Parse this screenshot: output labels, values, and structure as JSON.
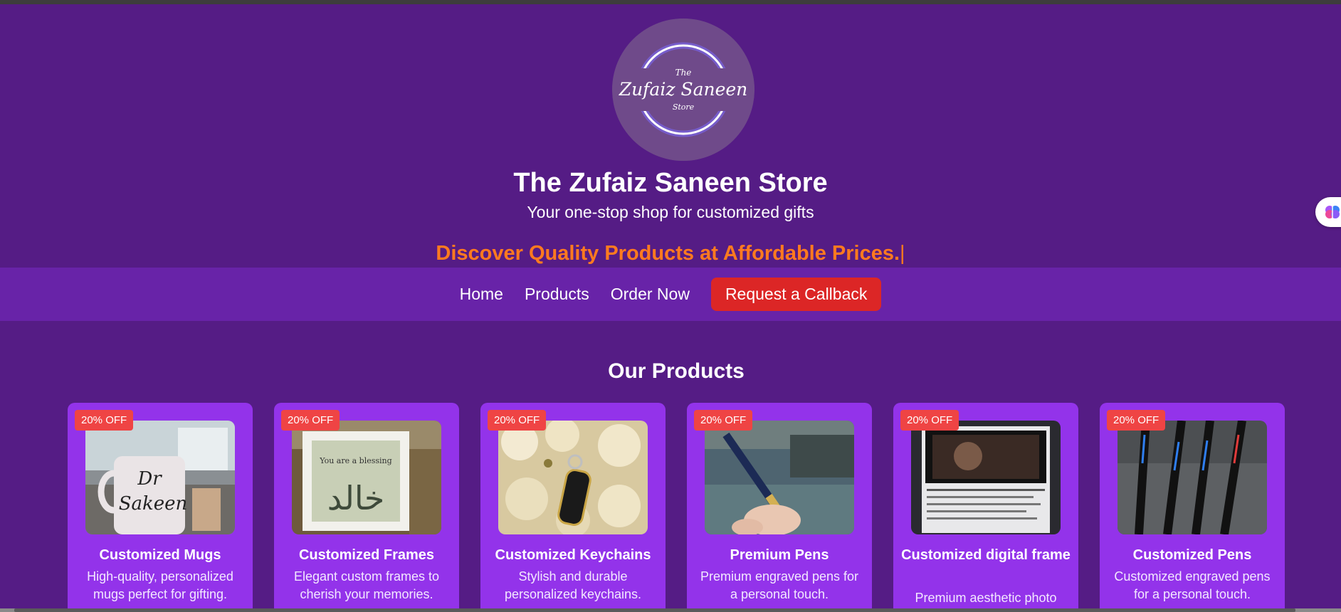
{
  "brand": {
    "logo_alt": "The Zufaiz Saneen Store",
    "logo_text_top": "The",
    "logo_text_main": "Zufaiz Saneen",
    "logo_text_bottom": "Store",
    "title": "The Zufaiz Saneen Store",
    "tagline": "Your one-stop shop for customized gifts",
    "typed_text": "Discover Quality Products at Affordable Prices.",
    "typed_cursor": "|"
  },
  "nav": {
    "links": [
      "Home",
      "Products",
      "Order Now"
    ],
    "callback_label": "Request a Callback"
  },
  "products": {
    "heading": "Our Products",
    "items": [
      {
        "badge": "20% OFF",
        "title": "Customized Mugs",
        "desc": "High-quality, personalized mugs perfect for gifting.",
        "image": "mug-photo"
      },
      {
        "badge": "20% OFF",
        "title": "Customized Frames",
        "desc": "Elegant custom frames to cherish your memories.",
        "image": "frame-photo"
      },
      {
        "badge": "20% OFF",
        "title": "Customized Keychains",
        "desc": "Stylish and durable personalized keychains.",
        "image": "keychain-photo"
      },
      {
        "badge": "20% OFF",
        "title": "Premium Pens",
        "desc": "Premium engraved pens for a personal touch.",
        "image": "pen-photo"
      },
      {
        "badge": "20% OFF",
        "title": "Customized digital frame",
        "desc": "Premium aesthetic photo",
        "image": "digital-frame-photo"
      },
      {
        "badge": "20% OFF",
        "title": "Customized Pens",
        "desc": "Customized engraved pens for a personal touch.",
        "image": "pens-photo"
      }
    ]
  },
  "colors": {
    "background": "#551c85",
    "nav_bar": "#6823a8",
    "card": "#9333ea",
    "badge": "#ef4444",
    "callback_button": "#dc2626",
    "typed_text": "#ff7a1f"
  },
  "icons": {
    "side_widget": "brain-icon"
  }
}
